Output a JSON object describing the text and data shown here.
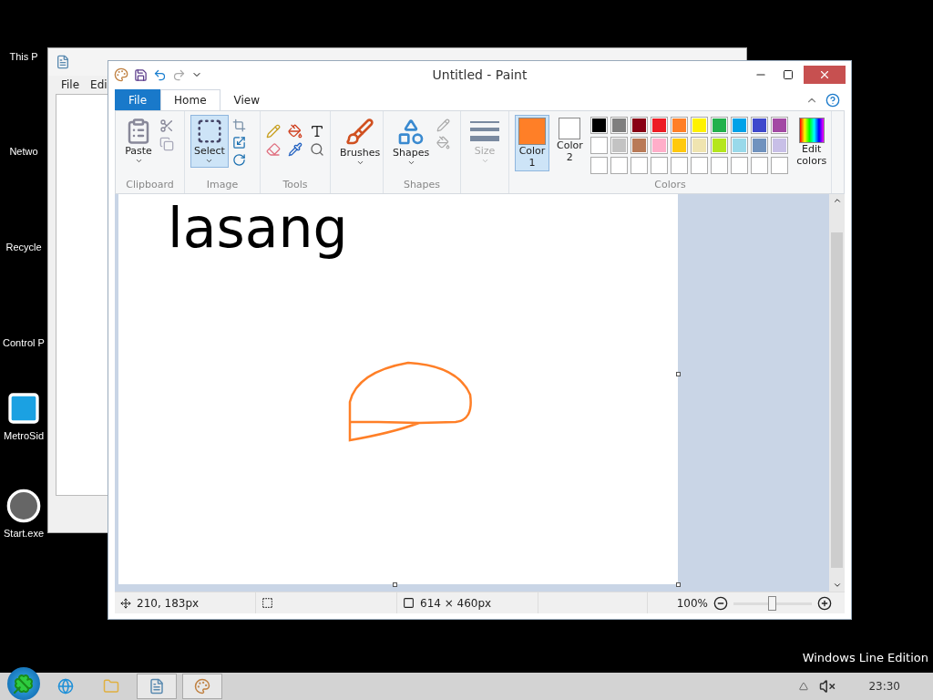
{
  "desktop": {
    "icons": [
      {
        "label": "This P",
        "kind": "pc"
      },
      {
        "label": "Netwo",
        "kind": "network"
      },
      {
        "label": "Recycle",
        "kind": "bin"
      },
      {
        "label": "Control P",
        "kind": "control"
      },
      {
        "label": "MetroSid",
        "kind": "metro"
      },
      {
        "label": "Start.exe",
        "kind": "start"
      }
    ],
    "edition_label": "Windows Line Edition"
  },
  "notepad": {
    "menu": [
      "File",
      "Edi"
    ]
  },
  "paint": {
    "title": "Untitled - Paint",
    "tabs": [
      {
        "label": "File",
        "kind": "file",
        "selected": false
      },
      {
        "label": "Home",
        "kind": "tab",
        "selected": true
      },
      {
        "label": "View",
        "kind": "tab",
        "selected": false
      }
    ],
    "clipboard": {
      "label": "Clipboard",
      "paste": "Paste"
    },
    "image": {
      "label": "Image",
      "select": {
        "label": "Select",
        "selected": true
      }
    },
    "tools": {
      "label": "Tools"
    },
    "brushes": {
      "label": "Brushes"
    },
    "shapes": {
      "label": "Shapes",
      "button": "Shapes"
    },
    "size": {
      "label": "Size",
      "disabled": true
    },
    "colors": {
      "label": "Colors",
      "slots": [
        {
          "label": "Color",
          "index": "1",
          "color": "#ff7f27",
          "selected": true
        },
        {
          "label": "Color",
          "index": "2",
          "color": "#ffffff",
          "selected": false
        }
      ],
      "palette": [
        [
          {
            "kind": "color",
            "color": "#000000"
          },
          {
            "kind": "color",
            "color": "#7f7f7f"
          },
          {
            "kind": "color",
            "color": "#880015"
          },
          {
            "kind": "color",
            "color": "#ed1c24"
          },
          {
            "kind": "color",
            "color": "#ff7f27"
          },
          {
            "kind": "color",
            "color": "#fff200"
          },
          {
            "kind": "color",
            "color": "#22b14c"
          },
          {
            "kind": "color",
            "color": "#00a2e8"
          },
          {
            "kind": "color",
            "color": "#3f48cc"
          },
          {
            "kind": "color",
            "color": "#a349a4"
          }
        ],
        [
          {
            "kind": "color",
            "color": "#ffffff"
          },
          {
            "kind": "color",
            "color": "#c3c3c3"
          },
          {
            "kind": "color",
            "color": "#b97a57"
          },
          {
            "kind": "color",
            "color": "#ffaec9"
          },
          {
            "kind": "color",
            "color": "#ffc90e"
          },
          {
            "kind": "color",
            "color": "#efe4b0"
          },
          {
            "kind": "color",
            "color": "#b5e61d"
          },
          {
            "kind": "color",
            "color": "#99d9ea"
          },
          {
            "kind": "color",
            "color": "#7092be"
          },
          {
            "kind": "color",
            "color": "#c8bfe7"
          }
        ],
        [
          {
            "kind": "empty"
          },
          {
            "kind": "empty"
          },
          {
            "kind": "empty"
          },
          {
            "kind": "empty"
          },
          {
            "kind": "empty"
          },
          {
            "kind": "empty"
          },
          {
            "kind": "empty"
          },
          {
            "kind": "empty"
          },
          {
            "kind": "empty"
          },
          {
            "kind": "empty"
          }
        ]
      ],
      "edit": "Edit colors"
    },
    "canvas": {
      "text": "lasang"
    },
    "status": {
      "position": "210, 183px",
      "size": "614 × 460px",
      "zoom": "100%",
      "zoom_slider": {
        "level": 0.5
      }
    }
  },
  "taskbar": {
    "buttons": [
      {
        "kind": "browser",
        "active": false
      },
      {
        "kind": "folder",
        "active": false
      },
      {
        "kind": "notepad",
        "active": true
      },
      {
        "kind": "paint",
        "active": true
      }
    ],
    "clock": "23:30"
  }
}
